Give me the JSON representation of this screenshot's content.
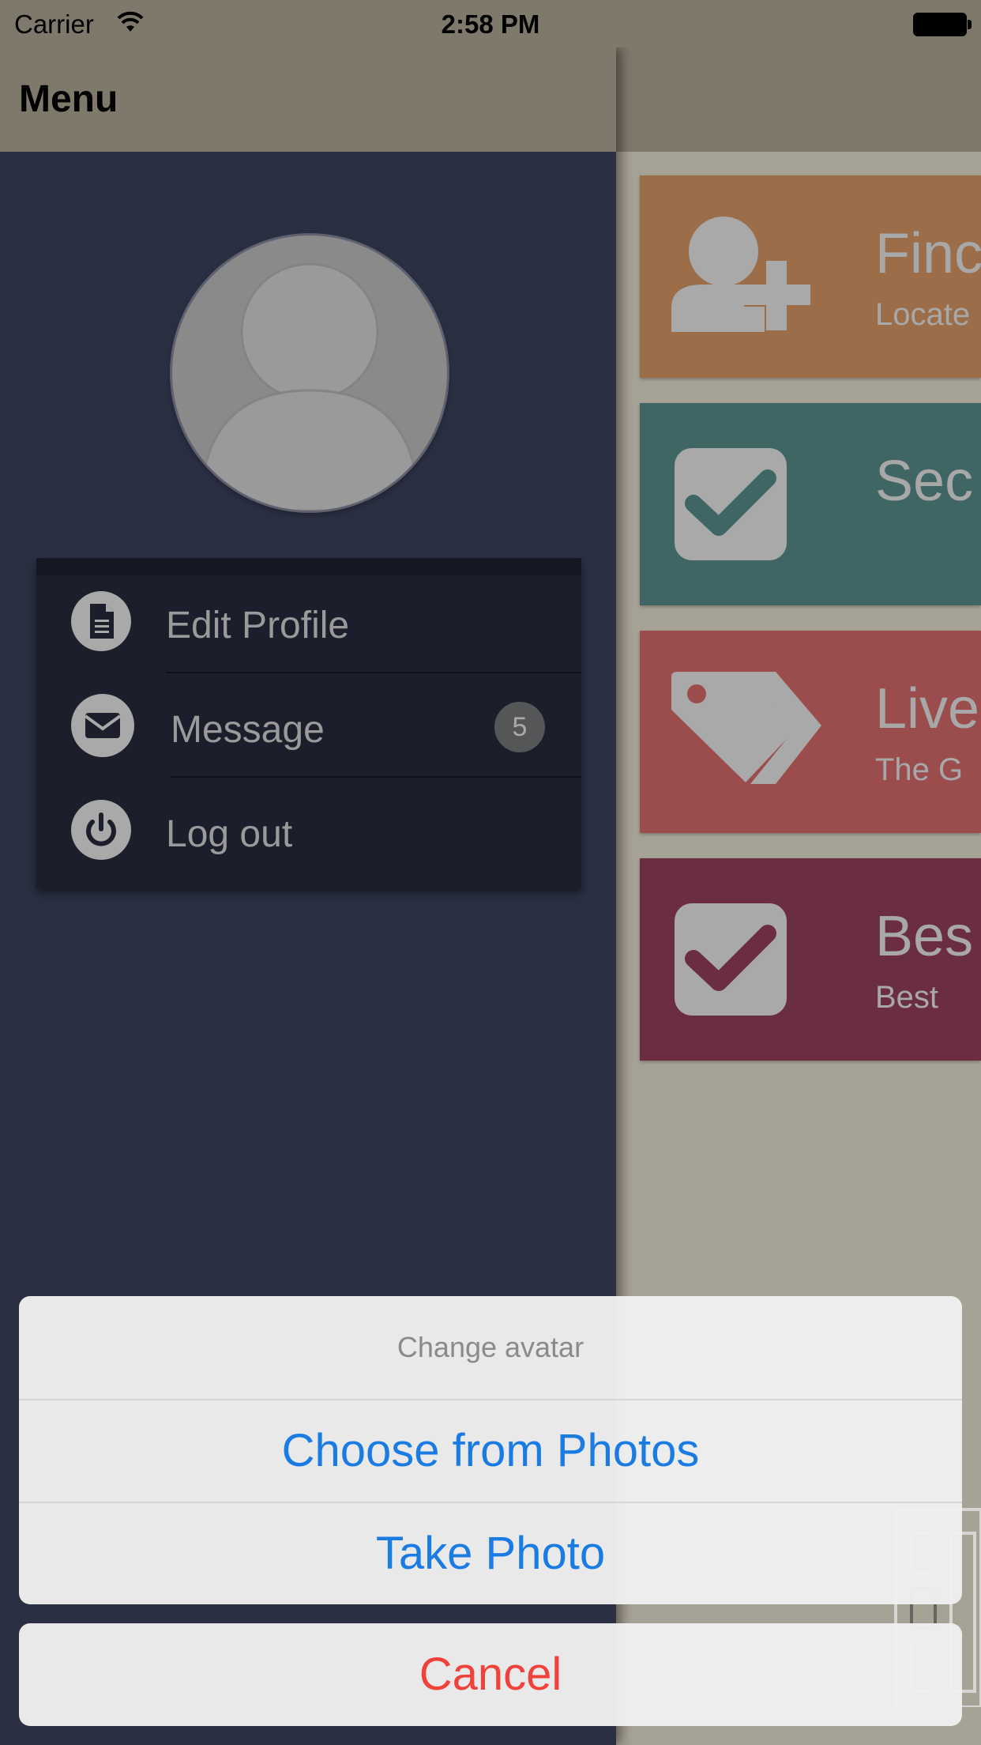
{
  "status_bar": {
    "carrier": "Carrier",
    "time": "2:58 PM"
  },
  "menu": {
    "title": "Menu",
    "items": [
      {
        "label": "Edit Profile",
        "icon": "document-icon"
      },
      {
        "label": "Message",
        "icon": "envelope-icon",
        "badge": "5"
      },
      {
        "label": "Log out",
        "icon": "power-icon"
      }
    ]
  },
  "tiles": [
    {
      "title": "Finc",
      "subtitle": "Locate",
      "color": "#9b6e49",
      "icon": "add-user-icon"
    },
    {
      "title": "Sec",
      "subtitle": "",
      "color": "#3f6664",
      "icon": "checkbox-icon"
    },
    {
      "title": "Live",
      "subtitle": "The G",
      "color": "#9b4d4d",
      "icon": "tags-icon"
    },
    {
      "title": "Bes",
      "subtitle": "Best",
      "color": "#6b2e40",
      "icon": "checkbox-icon"
    }
  ],
  "action_sheet": {
    "title": "Change avatar",
    "options": [
      "Choose from Photos",
      "Take Photo"
    ],
    "cancel": "Cancel"
  },
  "colors": {
    "nav_bar": "#7f796b",
    "menu_background": "#2a2f42",
    "action_blue": "#1a7be3",
    "cancel_red": "#f0423a"
  }
}
